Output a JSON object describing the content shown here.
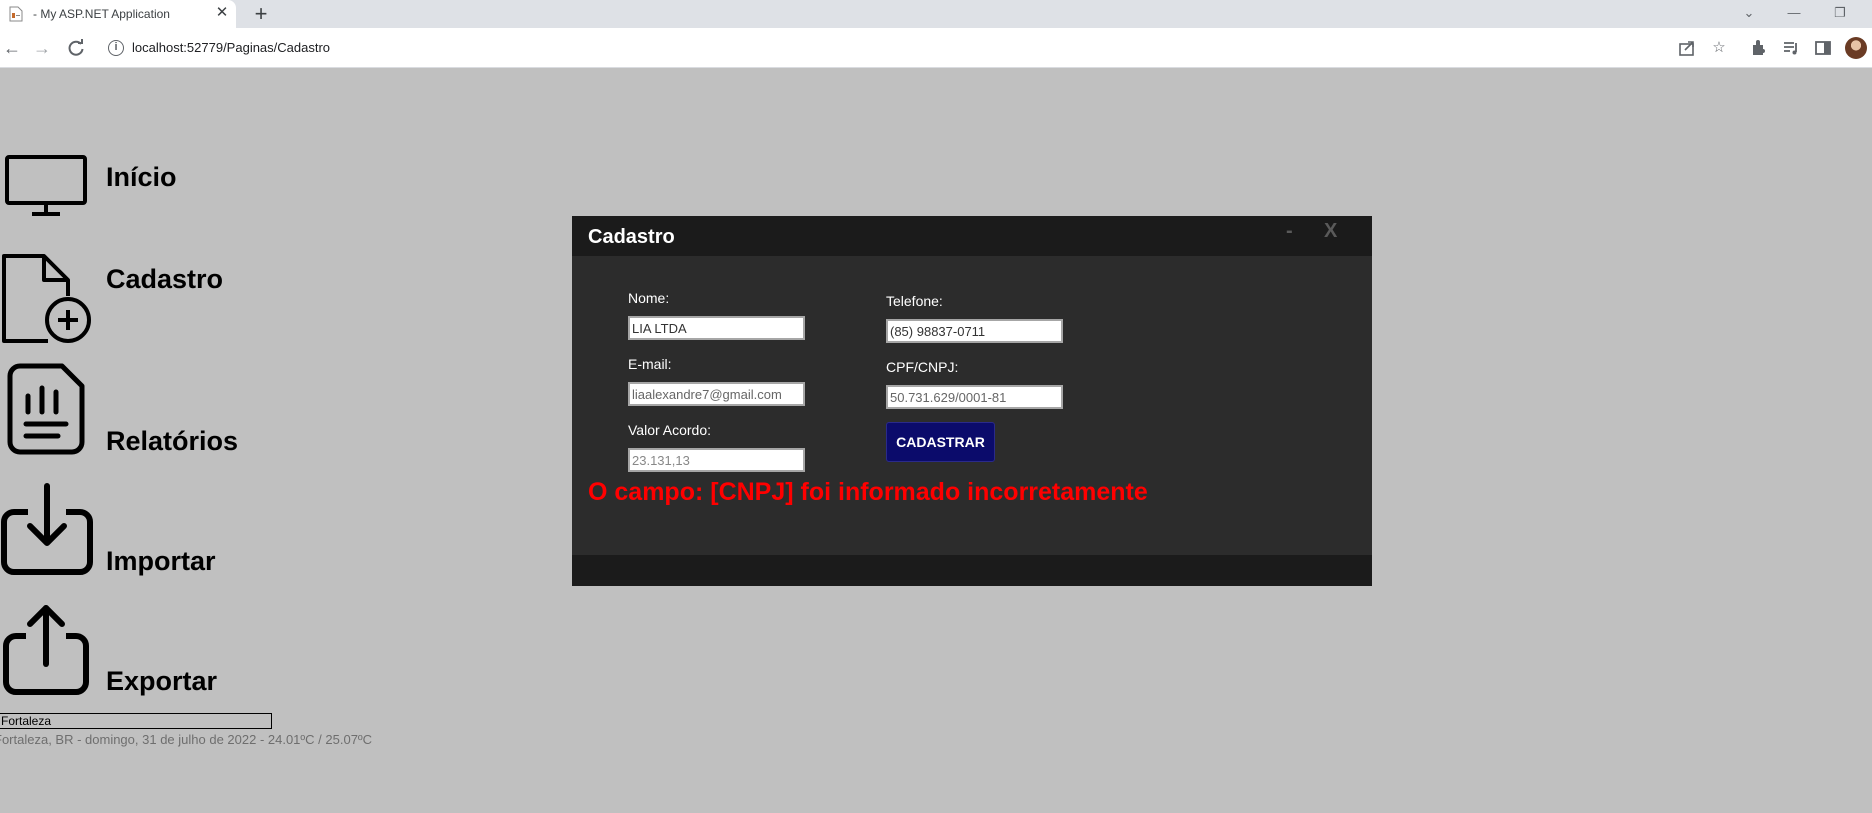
{
  "browser": {
    "tab_title": "- My ASP.NET Application",
    "tab_close": "✕",
    "new_tab": "+",
    "url": "localhost:52779/Paginas/Cadastro",
    "url_info_icon": "i",
    "window_controls": [
      "⌄",
      "—",
      "❐"
    ]
  },
  "nav": {
    "items": [
      {
        "label": "Início",
        "icon": "monitor-icon"
      },
      {
        "label": "Cadastro",
        "icon": "file-add-icon"
      },
      {
        "label": "Relatórios",
        "icon": "report-icon"
      },
      {
        "label": "Importar",
        "icon": "download-icon"
      },
      {
        "label": "Exportar",
        "icon": "upload-icon"
      }
    ]
  },
  "weather": {
    "city_value": "Fortaleza",
    "info": "Fortaleza, BR - domingo, 31 de julho de 2022 - 24.01ºC / 25.07ºC"
  },
  "modal": {
    "title": "Cadastro",
    "minimize": "-",
    "close": "X",
    "fields": {
      "nome": {
        "label": "Nome:",
        "value": "LIA LTDA"
      },
      "email": {
        "label": "E-mail:",
        "value": "liaalexandre7@gmail.com"
      },
      "valor": {
        "label": "Valor Acordo:",
        "value": "23.131,13"
      },
      "telefone": {
        "label": "Telefone:",
        "value": "(85) 98837-0711"
      },
      "cpf_cnpj": {
        "label": "CPF/CNPJ:",
        "value": "50.731.629/0001-81"
      }
    },
    "submit_label": "CADASTRAR",
    "error": "O campo: [CNPJ] foi informado incorretamente"
  },
  "colors": {
    "page_bg": "#c0c0c0",
    "modal_bg": "#2c2c2c",
    "modal_bar": "#1b1b1b",
    "button_bg": "#0b0b6b",
    "error": "#ff0000"
  }
}
